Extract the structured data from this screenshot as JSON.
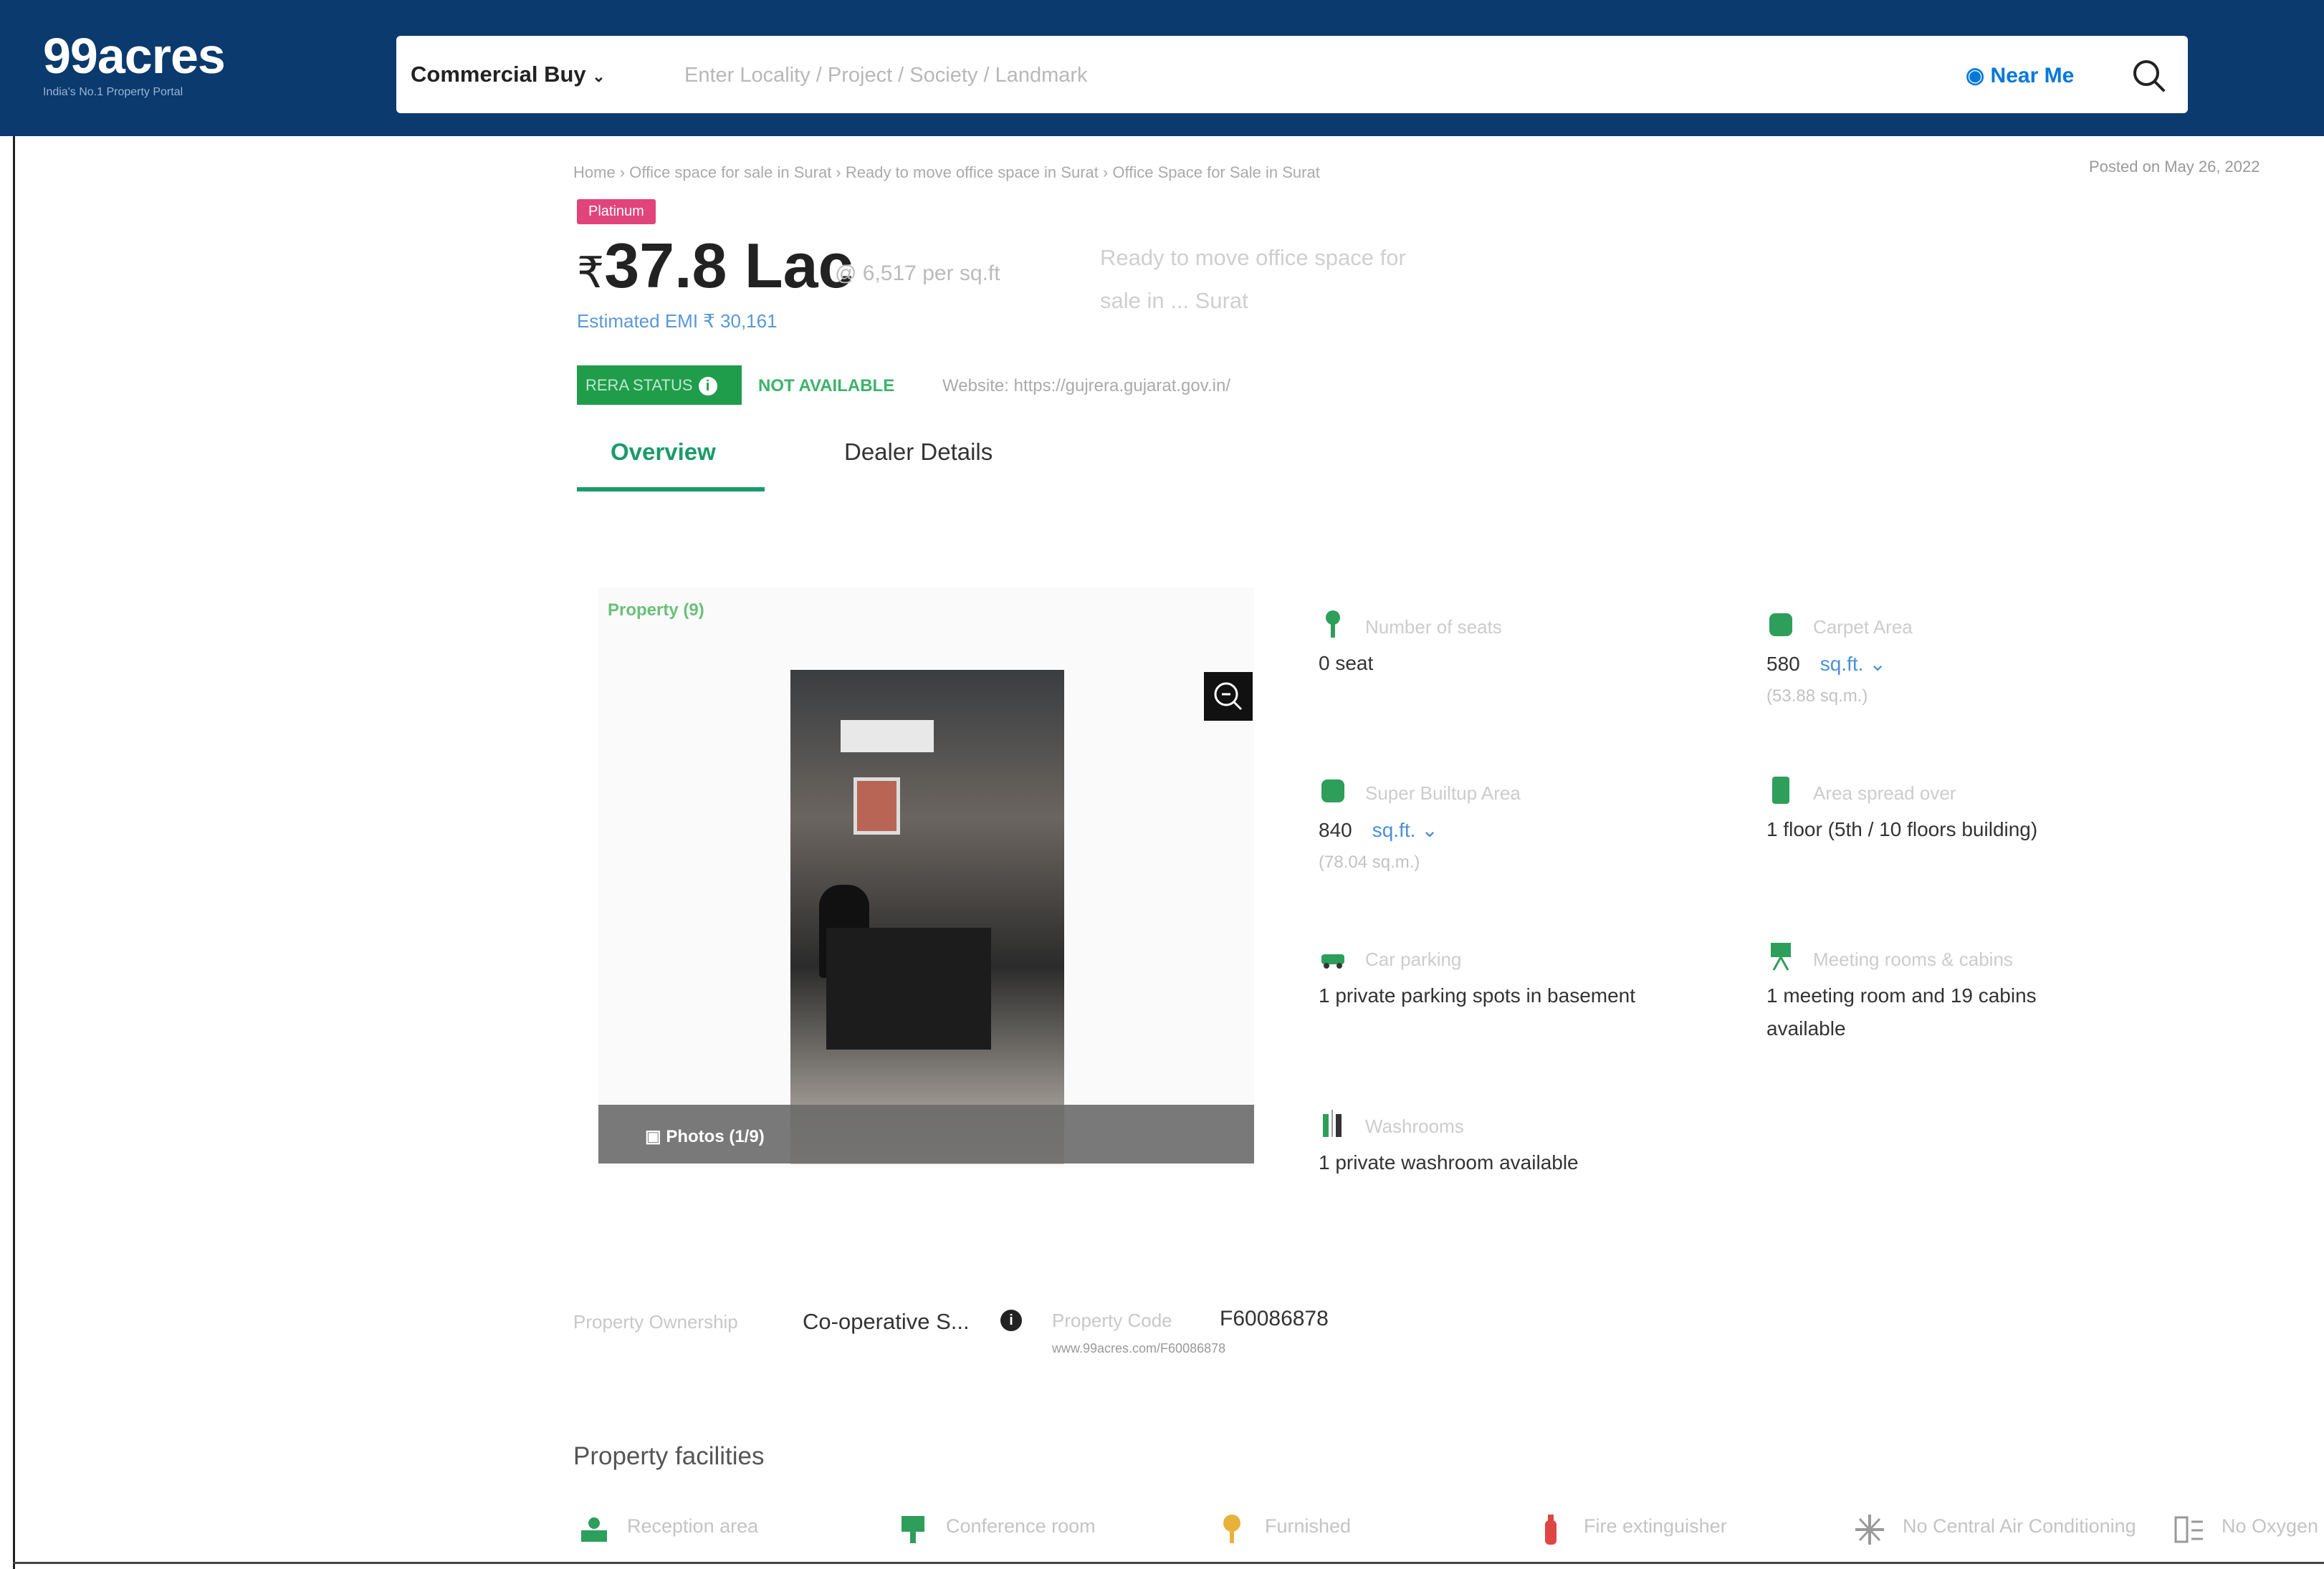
{
  "header": {
    "logo": "99acres",
    "logo_tagline": "India's No.1 Property Portal",
    "dropdown_label": "Commercial Buy",
    "search_placeholder": "Enter Locality / Project / Society / Landmark",
    "near_me": "Near Me"
  },
  "breadcrumb": "Home › Office space for sale in Surat › Ready to move office space in Surat › Office Space for Sale in Surat",
  "posted": "Posted on May 26, 2022",
  "listing": {
    "badge": "Platinum",
    "price": "37.8 Lac",
    "currency_symbol": "₹",
    "per_sqft": "@ 6,517 per sq.ft",
    "title_line1": "Ready to move office space for",
    "title_line2": "sale in ... Surat",
    "emi": "Estimated EMI ₹ 30,161",
    "rera_status": "RERA STATUS",
    "rera_value": "NOT AVAILABLE",
    "website": "Website: https://gujrera.gujarat.gov.in/"
  },
  "tabs": [
    {
      "label": "Overview"
    },
    {
      "label": "Dealer Details"
    }
  ],
  "photo_section": {
    "label": "Property (9)",
    "photos_button": "Photos (1/9)"
  },
  "features": [
    {
      "label": "Number of seats",
      "value": "0 seat",
      "unit": "",
      "sub": ""
    },
    {
      "label": "Carpet Area",
      "value": "580",
      "unit": "sq.ft.",
      "sub": "(53.88 sq.m.)"
    },
    {
      "label": "Super Builtup Area",
      "value": "840",
      "unit": "sq.ft.",
      "sub": "(78.04 sq.m.)"
    },
    {
      "label": "Area spread over",
      "value": "1 floor (5th / 10 floors building)",
      "unit": "",
      "sub": ""
    },
    {
      "label": "Car parking",
      "value": "1 private parking spots in basement",
      "unit": "",
      "sub": ""
    },
    {
      "label": "Meeting rooms & cabins",
      "value": "1 meeting room and 19 cabins",
      "value2": "available",
      "unit": "",
      "sub": ""
    },
    {
      "label": "Washrooms",
      "value": "1 private washroom available",
      "unit": "",
      "sub": ""
    }
  ],
  "ownership": {
    "label": "Property Ownership",
    "value": "Co-operative S...",
    "code_label": "Property Code",
    "code_value": "F60086878",
    "code_url": "www.99acres.com/F60086878"
  },
  "facilities": {
    "title": "Property facilities",
    "items": [
      {
        "label": "Reception area",
        "icon": "reception-icon",
        "color": "#2e9e5b"
      },
      {
        "label": "Conference room",
        "icon": "conference-icon",
        "color": "#2e9e5b"
      },
      {
        "label": "Furnished",
        "icon": "furnished-icon",
        "color": "#e8b23a"
      },
      {
        "label": "Fire extinguisher",
        "icon": "fire-extinguisher-icon",
        "color": "#e04545"
      },
      {
        "label": "No Central Air Conditioning",
        "icon": "ac-icon",
        "color": "#999999"
      },
      {
        "label": "No Oxygen",
        "icon": "oxygen-icon",
        "color": "#999999"
      }
    ]
  },
  "colors": {
    "header_bg": "#0a3a6e",
    "accent_green": "#1a9b6a",
    "link_blue": "#0078db",
    "badge_pink": "#e0447a"
  }
}
